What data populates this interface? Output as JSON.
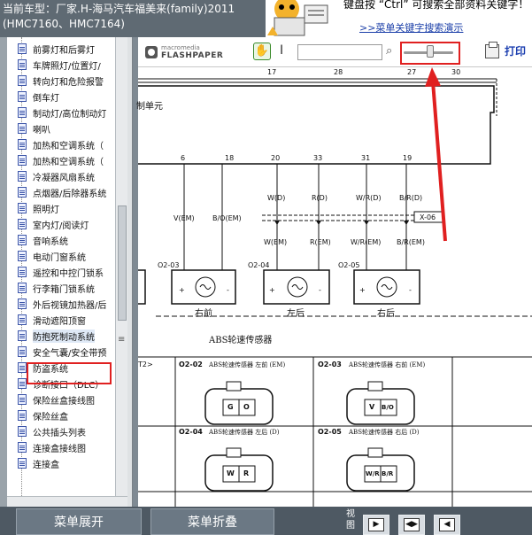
{
  "header": {
    "vehicle_line1": "当前车型：厂家.H-海马汽车福美来(family)2011",
    "vehicle_line2": "(HMC7160、HMC7164)",
    "hint_text": "键盘按 “Ctrl” 可搜索全部资料关键字！",
    "search_link": ">>菜单关键字搜索演示"
  },
  "tree": {
    "items": [
      {
        "label": "前雾灯和后雾灯"
      },
      {
        "label": "车牌照灯/位置灯/"
      },
      {
        "label": "转向灯和危险报警"
      },
      {
        "label": "倒车灯"
      },
      {
        "label": "制动灯/高位制动灯"
      },
      {
        "label": "喇叭"
      },
      {
        "label": "加热和空调系统（"
      },
      {
        "label": "加热和空调系统（"
      },
      {
        "label": "冷凝器风扇系统"
      },
      {
        "label": "点烟器/后除器系统"
      },
      {
        "label": "照明灯"
      },
      {
        "label": "室内灯/阅读灯"
      },
      {
        "label": "音响系统"
      },
      {
        "label": "电动门窗系统"
      },
      {
        "label": "遥控和中控门锁系"
      },
      {
        "label": "行李箱门锁系统"
      },
      {
        "label": "外后视镜加热器/后"
      },
      {
        "label": "滑动遮阳顶窗"
      },
      {
        "label": "防抱死制动系统"
      },
      {
        "label": "安全气囊/安全带预"
      },
      {
        "label": "防盗系统"
      },
      {
        "label": "诊断接口（DLC）"
      },
      {
        "label": "保险丝盒接线图"
      },
      {
        "label": "保险丝盒"
      },
      {
        "label": "公共插头列表"
      },
      {
        "label": "连接盒接线图"
      },
      {
        "label": "连接盒"
      }
    ],
    "selected_index": 18
  },
  "viewer": {
    "logo_small": "macromedia",
    "logo_big": "FLASHPAPER",
    "print_label": "打印",
    "search_value": ""
  },
  "diagram": {
    "top_pins": [
      "17",
      "28",
      "27",
      "30"
    ],
    "ecu_label": "制单元",
    "pins": [
      "6",
      "18",
      "20",
      "33",
      "31",
      "19"
    ],
    "wires_top": [
      "W(D)",
      "R(D)",
      "W/R(D)",
      "B/R(D)"
    ],
    "connector_x06": "X-06",
    "wires_mid": [
      "V(EM)",
      "B/O(EM)",
      "W(EM)",
      "R(EM)",
      "W/R(EM)",
      "B/R(EM)"
    ],
    "sensor_ids": [
      "O2-03",
      "O2-04",
      "O2-05"
    ],
    "sensor_pos": [
      "右前",
      "左后",
      "右后"
    ],
    "caption": "ABS轮速传感器",
    "conn_table": [
      {
        "id": "O2-02",
        "desc": "ABS轮速传感器 左前 (EM)",
        "pins": [
          "G",
          "O"
        ]
      },
      {
        "id": "O2-03",
        "desc": "ABS轮速传感器 右前 (EM)",
        "pins": [
          "V",
          "B/O"
        ]
      },
      {
        "id": "O2-04",
        "desc": "ABS轮速传感器 左后 (D)",
        "pins": [
          "W",
          "R"
        ]
      },
      {
        "id": "O2-05",
        "desc": "ABS轮速传感器 右后 (D)",
        "pins": [
          "W/R",
          "B/R"
        ]
      }
    ],
    "table_left_label": "T2>",
    "plus": "+",
    "minus": "-"
  },
  "bottom": {
    "expand_label": "菜单展开",
    "collapse_label": "菜单折叠",
    "view_label": "视图"
  },
  "colors": {
    "annotation_red": "#e02020",
    "link_blue": "#1a3ea8",
    "bar_gray": "#4e5963"
  }
}
